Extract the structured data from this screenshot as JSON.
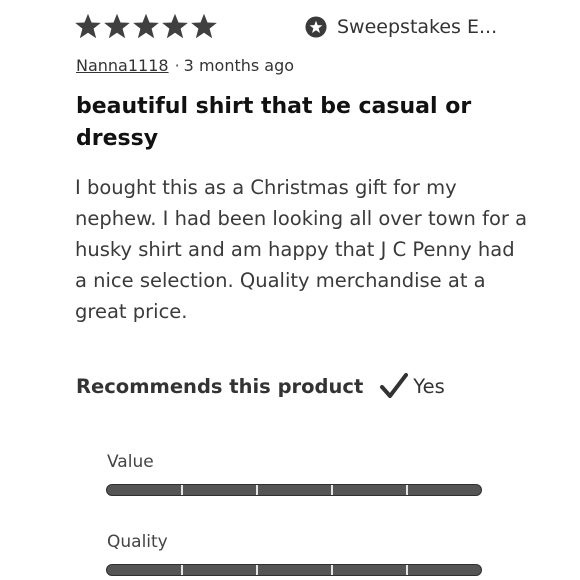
{
  "review": {
    "rating": 5,
    "rating_max": 5,
    "badge_icon": "star-circle-icon",
    "badge_label": "Sweepstakes E...",
    "username": "Nanna1118",
    "separator": "·",
    "time_ago": "3 months ago",
    "title": "beautiful shirt that be casual or dressy",
    "body": "I bought this as a Christmas gift for my nephew. I had been looking all over town for a husky shirt and am happy that J C Penny had a nice selection. Quality merchandise at a great price.",
    "recommends": {
      "label": "Recommends this product",
      "icon": "checkmark-icon",
      "value": "Yes"
    },
    "attributes": [
      {
        "label": "Value",
        "score": 5,
        "max": 5
      },
      {
        "label": "Quality",
        "score": 5,
        "max": 5
      }
    ]
  },
  "colors": {
    "star": "#404040",
    "bar_fill": "#555555",
    "text_primary": "#111111",
    "text_body": "#3a3a3a"
  }
}
